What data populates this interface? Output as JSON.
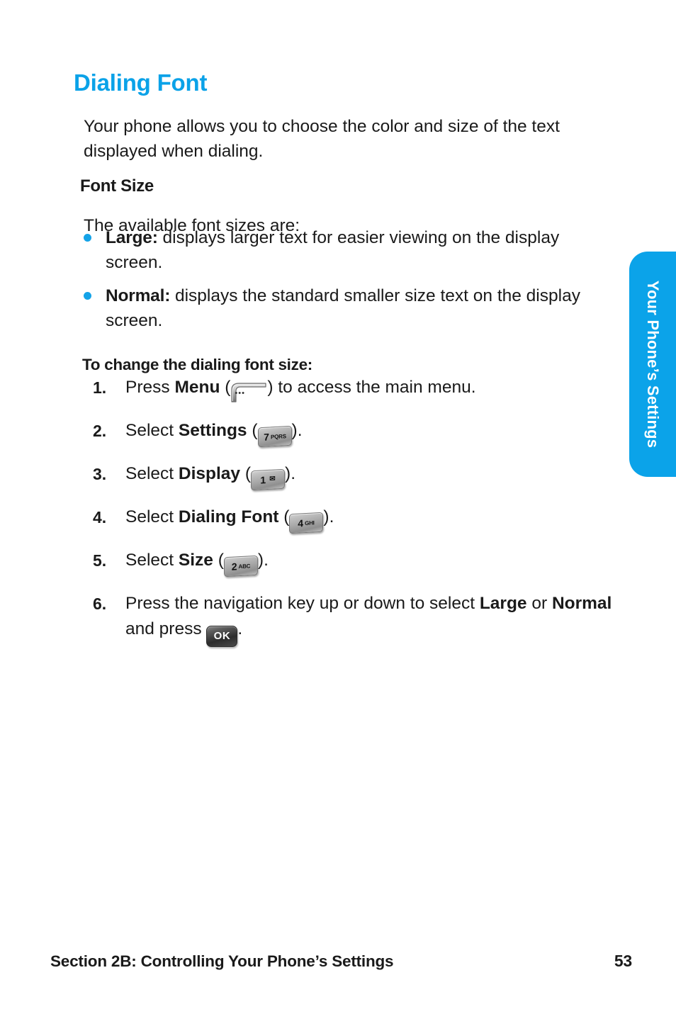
{
  "page": {
    "title": "Dialing Font",
    "intro": "Your phone allows you to choose the color and size of the text displayed when dialing.",
    "accent_color": "#0aa2e8",
    "bullet_color": "#14a3e8"
  },
  "font_size_section": {
    "heading": "Font Size",
    "lead": "The available font sizes are:",
    "options": [
      {
        "term": "Large:",
        "description": "displays larger text for easier viewing on the display screen."
      },
      {
        "term": "Normal:",
        "description": "displays the standard smaller size text on the display screen."
      }
    ]
  },
  "procedure": {
    "heading": "To change the dialing font size:",
    "steps": [
      {
        "number": "1.",
        "before": "Press ",
        "bold": "Menu",
        "mid": " (",
        "key": {
          "type": "softkey",
          "name": "menu-soft-key",
          "dots": "•••"
        },
        "after": ") to access the main menu."
      },
      {
        "number": "2.",
        "before": "Select ",
        "bold": "Settings",
        "mid": " (",
        "key": {
          "type": "keycap",
          "name": "key-7-pqrs",
          "digit": "7",
          "letters": "PQRS"
        },
        "after": ")."
      },
      {
        "number": "3.",
        "before": "Select ",
        "bold": "Display",
        "mid": " (",
        "key": {
          "type": "keycap",
          "name": "key-1-voicemail",
          "digit": "1",
          "letters": "",
          "glyph": "✉"
        },
        "after": ")."
      },
      {
        "number": "4.",
        "before": "Select ",
        "bold": "Dialing Font",
        "mid": " (",
        "key": {
          "type": "keycap",
          "name": "key-4-ghi",
          "digit": "4",
          "letters": "GHI"
        },
        "after": ")."
      },
      {
        "number": "5.",
        "before": "Select ",
        "bold": "Size",
        "mid": " (",
        "key": {
          "type": "keycap",
          "name": "key-2-abc",
          "digit": "2",
          "letters": "ABC"
        },
        "after": ")."
      },
      {
        "number": "6.",
        "before": "Press the navigation key up or down to select ",
        "bold": "Large",
        "mid": " or ",
        "bold2": "Normal",
        "mid2": " and press ",
        "key": {
          "type": "okkey",
          "name": "ok-key",
          "label": "OK"
        },
        "after": "."
      }
    ]
  },
  "side_tab": {
    "label": "Your Phone’s Settings",
    "color": "#0ba3e9"
  },
  "footer": {
    "section": "Section 2B: Controlling Your Phone’s Settings",
    "page_number": "53"
  }
}
